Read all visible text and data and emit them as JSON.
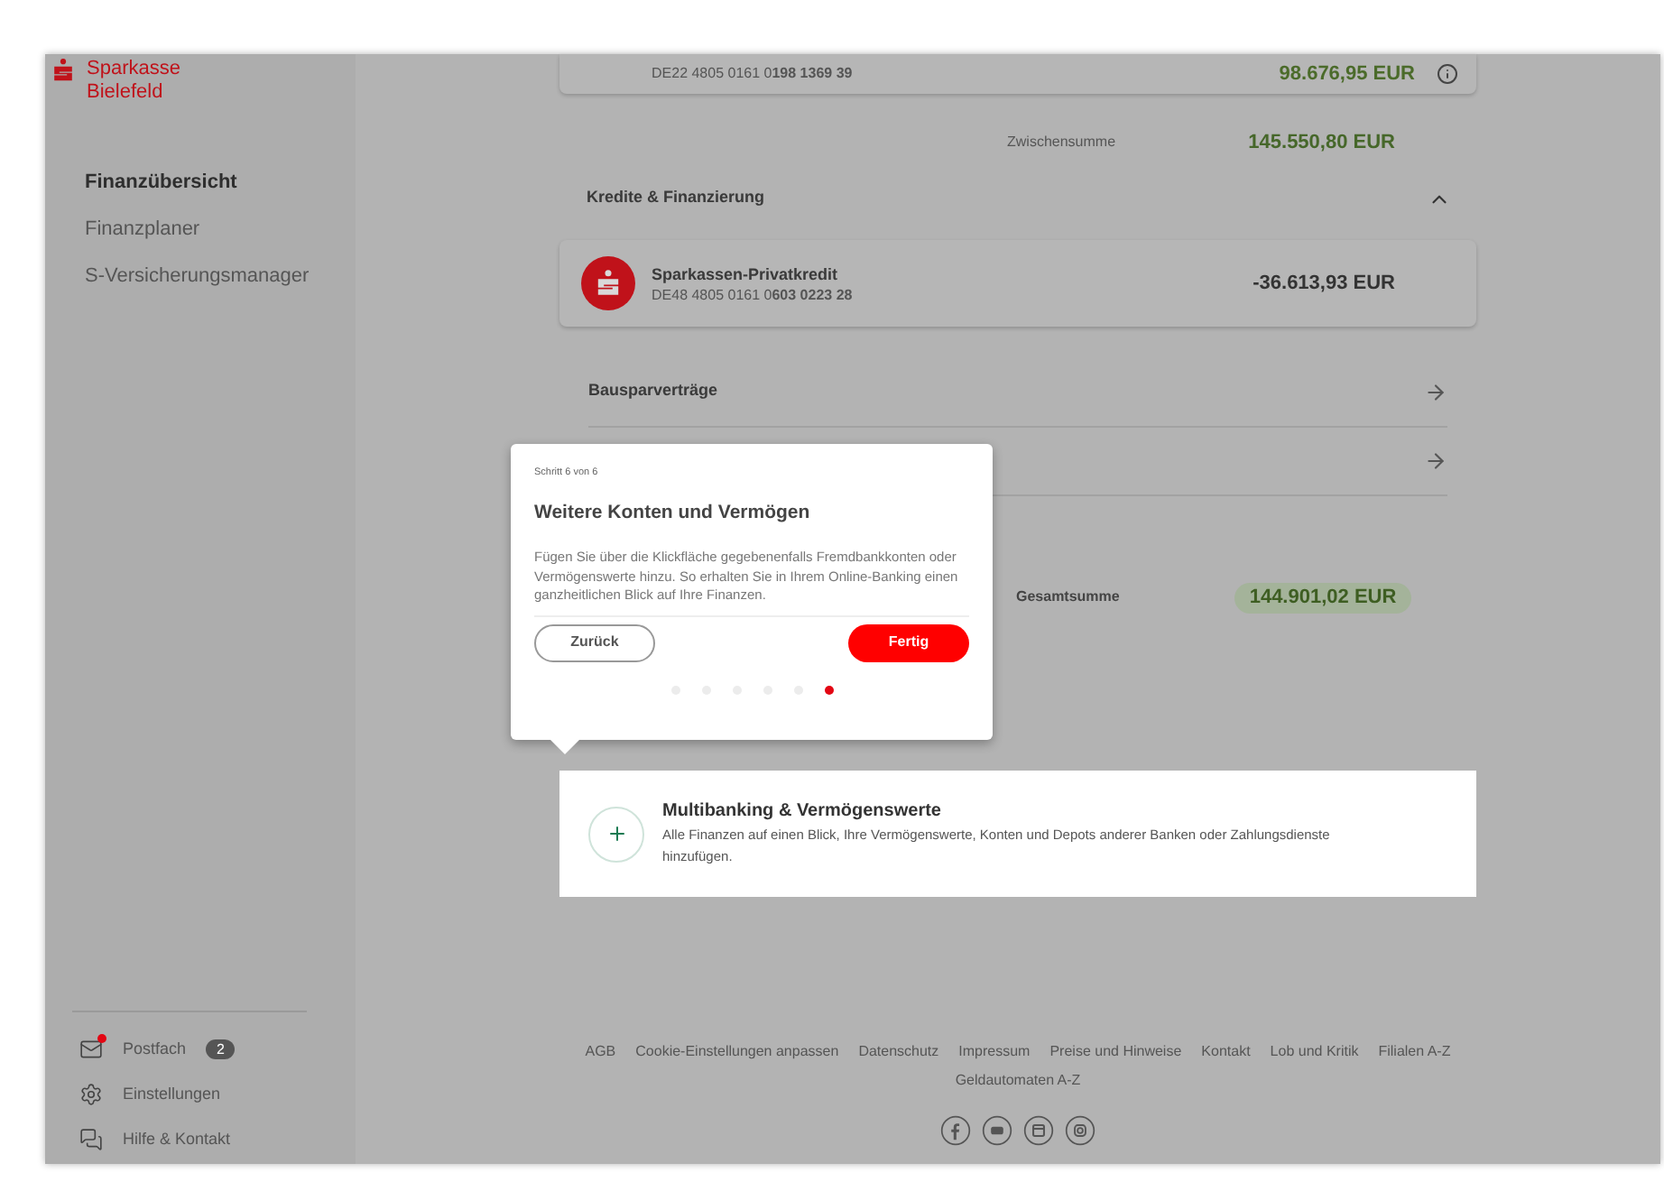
{
  "sidebar": {
    "logo": [
      "Sparkasse",
      "Bielefeld"
    ],
    "nav": [
      {
        "label": "Finanzübersicht",
        "selected": true
      },
      {
        "label": "Finanzplaner",
        "selected": false
      },
      {
        "label": "S-Versicherungsmanager",
        "selected": false
      }
    ],
    "bottom": [
      {
        "kind": "mail",
        "label": "Postfach",
        "badge": "2",
        "unread": true
      },
      {
        "kind": "settings",
        "label": "Einstellungen"
      },
      {
        "kind": "help",
        "label": "Hilfe & Kontakt"
      }
    ]
  },
  "top_account": {
    "iban": "DE22 4805 0161 0**198 1369 39**",
    "amount": "98.676,95 EUR"
  },
  "subtotal": {
    "label": "Zwischensumme",
    "amount": "145.550,80 EUR"
  },
  "credit_section": {
    "title": "Kredite & Finanzierung",
    "expanded": true,
    "accounts": [
      {
        "name": "Sparkassen-Privatkredit",
        "iban": "DE48 4805 0161 0**603 0223 28**",
        "amount": "-36.613,93 EUR"
      }
    ]
  },
  "link_rows": [
    {
      "label": "Bausparverträge"
    }
  ],
  "total": {
    "label": "Gesamtsumme",
    "amount": "144.901,02 EUR"
  },
  "multibanking": {
    "title": "Multibanking & Vermögenswerte",
    "text": "Alle Finanzen auf einen Blick, Ihre Vermögenswerte, Konten und Depots anderer Banken oder Zahlungsdienste hinzufügen."
  },
  "tour": {
    "step": "Schritt 6 von 6",
    "title": "Weitere Konten und Vermögen",
    "text": "Fügen Sie über die Klickfläche gegebenenfalls Fremdbankkonten oder Vermögenswerte hinzu. So erhalten Sie in Ihrem Online-Banking einen ganzheitlichen Blick auf Ihre Finanzen.",
    "back": "Zurück",
    "done": "Fertig",
    "dots": [
      {
        "selected": false
      },
      {
        "selected": false
      },
      {
        "selected": false
      },
      {
        "selected": false
      },
      {
        "selected": false
      },
      {
        "selected": true
      }
    ]
  },
  "footer": {
    "links": [
      "AGB",
      "Cookie-Einstellungen anpassen",
      "Datenschutz",
      "Impressum",
      "Preise und Hinweise",
      "Kontakt",
      "Lob und Kritik",
      "Filialen A-Z",
      "Geldautomaten A-Z"
    ],
    "social": [
      {
        "kind": "facebook"
      },
      {
        "kind": "youtube"
      },
      {
        "kind": "calendar"
      },
      {
        "kind": "instagram"
      }
    ]
  }
}
